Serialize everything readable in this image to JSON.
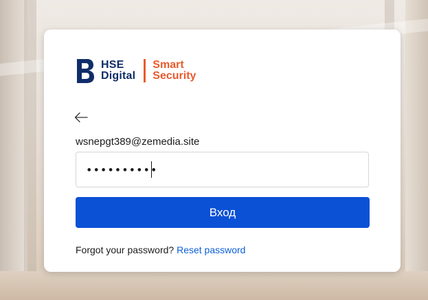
{
  "brand": {
    "line1": "HSE",
    "line2": "Digital",
    "sub1": "Smart",
    "sub2": "Security",
    "primary_color": "#0f2d69",
    "accent_color": "#ea5a2c"
  },
  "form": {
    "back_icon": "arrow-left-icon",
    "email": "wsnepgt389@zemedia.site",
    "password_value": "••••••••••",
    "submit_label": "Вход",
    "submit_color": "#0b51d6",
    "forgot_text": "Forgot your password?",
    "reset_link": "Reset password",
    "link_color": "#0b5fd6"
  }
}
